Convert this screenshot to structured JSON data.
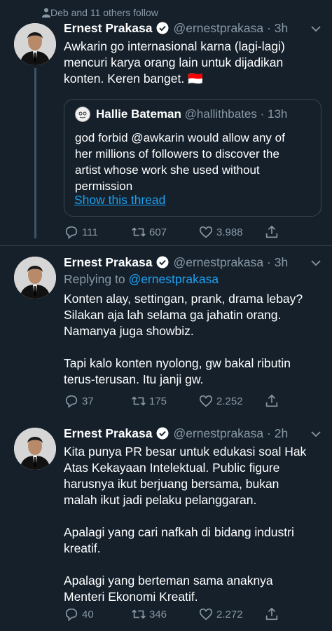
{
  "social_context": "Deb and 11 others follow",
  "tweets": [
    {
      "name": "Ernest Prakasa",
      "handle": "@ernestprakasa",
      "time": "3h",
      "text": "Awkarin go internasional karna (lagi-lagi)\nmencuri karya orang lain untuk dijadikan\nkonten. Keren banget. 🇮🇩",
      "quote": {
        "name": "Hallie Bateman",
        "handle": "@hallithbates",
        "time": "13h",
        "text": "god forbid @awkarin would allow any of\nher millions of followers to discover the\nartist whose work she used without\npermission",
        "show_thread": "Show this thread"
      },
      "replies": "111",
      "retweets": "607",
      "likes": "3.988"
    },
    {
      "name": "Ernest Prakasa",
      "handle": "@ernestprakasa",
      "time": "3h",
      "replying_label": "Replying to",
      "replying_handle": "@ernestprakasa",
      "text": "Konten alay, settingan, prank, drama lebay?\nSilakan aja lah selama ga jahatin orang.\nNamanya juga showbiz.\n\nTapi kalo konten nyolong, gw bakal ributin\nterus-terusan. Itu janji gw.",
      "replies": "37",
      "retweets": "175",
      "likes": "2.252"
    },
    {
      "name": "Ernest Prakasa",
      "handle": "@ernestprakasa",
      "time": "2h",
      "text": "Kita punya PR besar untuk edukasi soal Hak\nAtas Kekayaan Intelektual. Public figure\nharusnya ikut berjuang bersama, bukan\nmalah ikut jadi pelaku pelanggaran.\n\nApalagi yang cari nafkah di bidang industri\nkreatif.\n\nApalagi yang berteman sama anaknya\nMenteri Ekonomi Kreatif.",
      "replies": "40",
      "retweets": "346",
      "likes": "2.272"
    }
  ],
  "colors": {
    "background": "#15202b",
    "secondary_text": "#8899a6",
    "link": "#1da1f2",
    "border": "#38444d"
  },
  "icons": [
    "person-icon",
    "verified-icon",
    "chevron-down-icon",
    "reply-icon",
    "retweet-icon",
    "like-icon",
    "share-icon"
  ]
}
